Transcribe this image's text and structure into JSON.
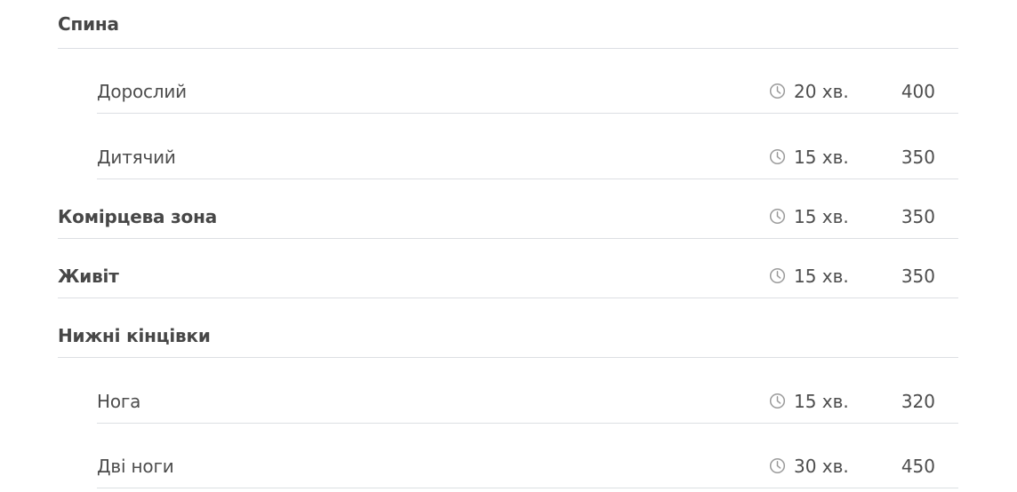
{
  "price_list": {
    "rows": [
      {
        "name": "Спина",
        "kind": "category",
        "duration": "",
        "price": ""
      },
      {
        "name": "Дорослий",
        "kind": "sub",
        "duration": "20 хв.",
        "price": "400"
      },
      {
        "name": "Дитячий",
        "kind": "sub",
        "duration": "15 хв.",
        "price": "350"
      },
      {
        "name": "Комірцева зона",
        "kind": "category",
        "duration": "15 хв.",
        "price": "350"
      },
      {
        "name": "Живіт",
        "kind": "category",
        "duration": "15 хв.",
        "price": "350"
      },
      {
        "name": "Нижні кінцівки",
        "kind": "category",
        "duration": "",
        "price": ""
      },
      {
        "name": "Нога",
        "kind": "sub",
        "duration": "15 хв.",
        "price": "320"
      },
      {
        "name": "Дві ноги",
        "kind": "sub",
        "duration": "30 хв.",
        "price": "450"
      }
    ],
    "icon": "clock-icon",
    "colors": {
      "text": "#4a4a4a",
      "divider": "#dcdfe3",
      "icon": "#9a9a9a"
    }
  }
}
